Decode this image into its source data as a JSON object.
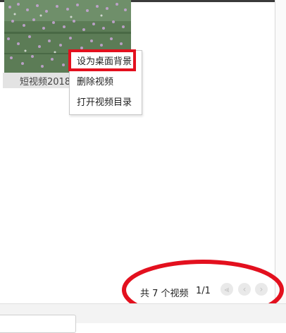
{
  "video": {
    "caption": "短视频2018"
  },
  "context_menu": {
    "items": [
      {
        "label": "设为桌面背景"
      },
      {
        "label": "删除视频"
      },
      {
        "label": "打开视频目录"
      }
    ]
  },
  "pager": {
    "total_text": "共 7 个视频",
    "page_text": "1/1",
    "first_icon": "first-page-icon",
    "prev_icon": "prev-page-icon",
    "next_icon": "next-page-icon"
  },
  "colors": {
    "highlight": "#e3101e",
    "annotation": "#e3101e"
  }
}
